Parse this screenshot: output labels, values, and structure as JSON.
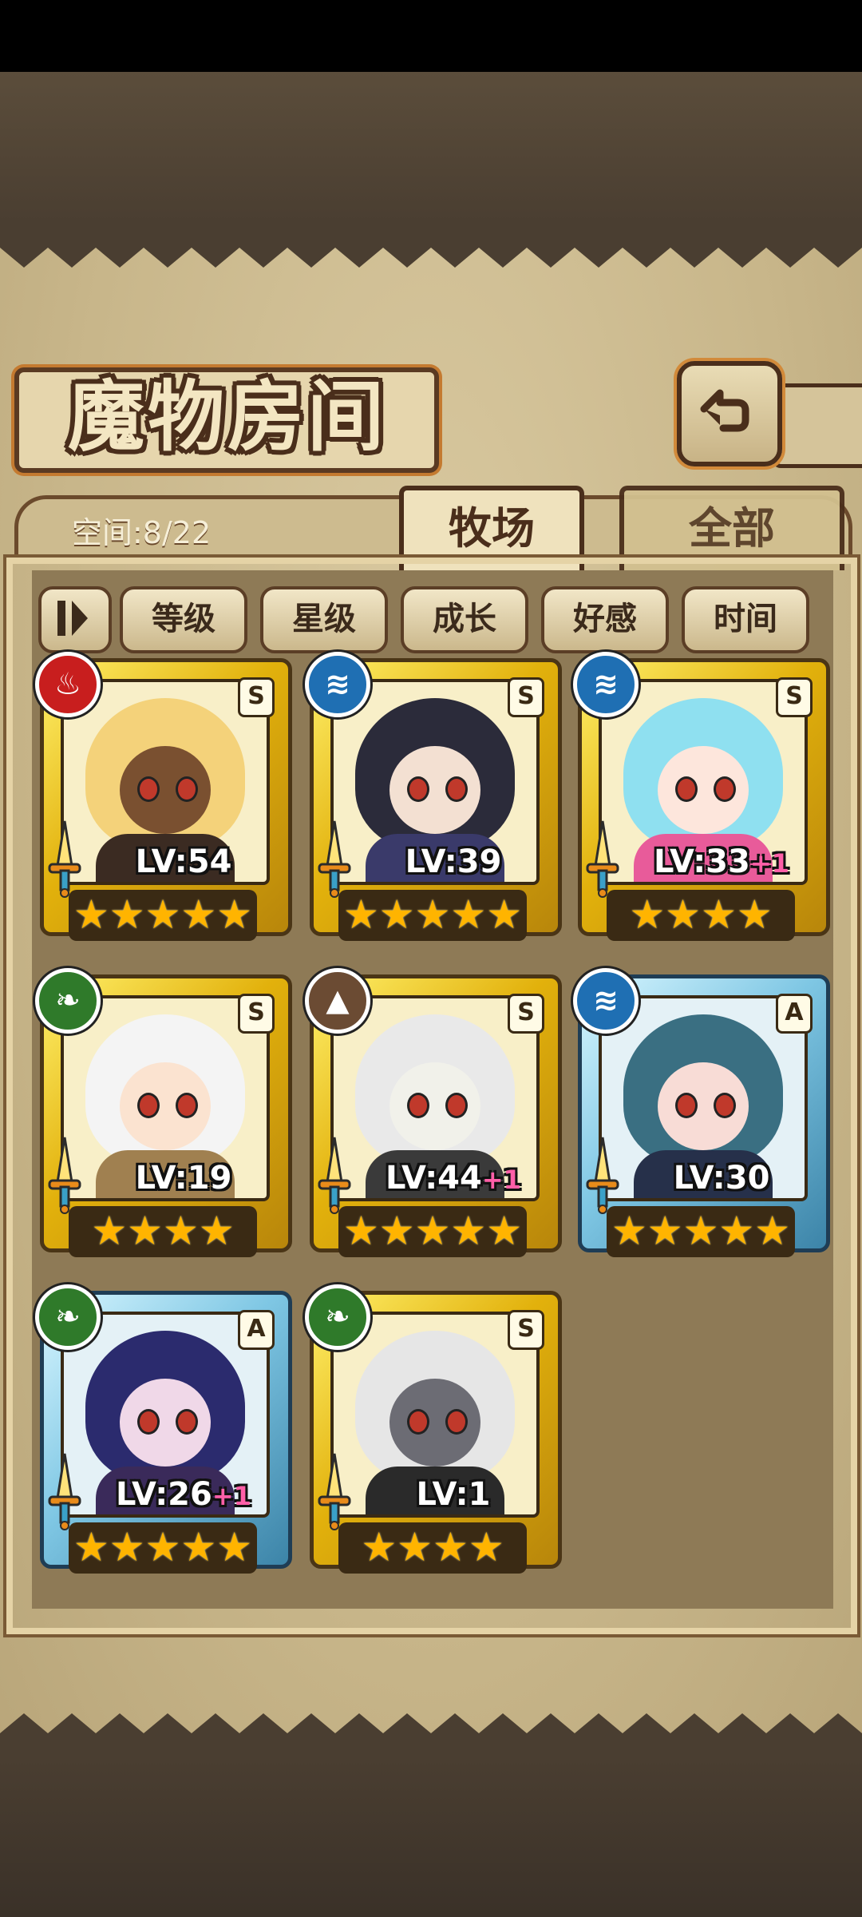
{
  "header": {
    "title": "魔物房间",
    "back_icon": "return-arrow-icon"
  },
  "tabs": {
    "space_label": "空间:8/22",
    "items": [
      {
        "label": "牧场",
        "active": true
      },
      {
        "label": "全部",
        "active": false
      }
    ]
  },
  "sort": {
    "toggle_icon": "sort-order-icon",
    "buttons": [
      "等级",
      "星级",
      "成长",
      "好感",
      "时间"
    ]
  },
  "monsters": [
    {
      "element": "fire",
      "rank": "S",
      "level": "LV:54",
      "bonus": "",
      "stars": 5,
      "frame": "gold"
    },
    {
      "element": "water",
      "rank": "S",
      "level": "LV:39",
      "bonus": "",
      "stars": 5,
      "frame": "gold"
    },
    {
      "element": "water",
      "rank": "S",
      "level": "LV:33",
      "bonus": "+1",
      "stars": 4,
      "frame": "gold"
    },
    {
      "element": "nature",
      "rank": "S",
      "level": "LV:19",
      "bonus": "",
      "stars": 4,
      "frame": "gold"
    },
    {
      "element": "earth",
      "rank": "S",
      "level": "LV:44",
      "bonus": "+1",
      "stars": 5,
      "frame": "gold"
    },
    {
      "element": "water",
      "rank": "A",
      "level": "LV:30",
      "bonus": "",
      "stars": 5,
      "frame": "blue"
    },
    {
      "element": "nature",
      "rank": "A",
      "level": "LV:26",
      "bonus": "+1",
      "stars": 5,
      "frame": "blue"
    },
    {
      "element": "nature",
      "rank": "S",
      "level": "LV:1",
      "bonus": "",
      "stars": 4,
      "frame": "gold"
    }
  ]
}
